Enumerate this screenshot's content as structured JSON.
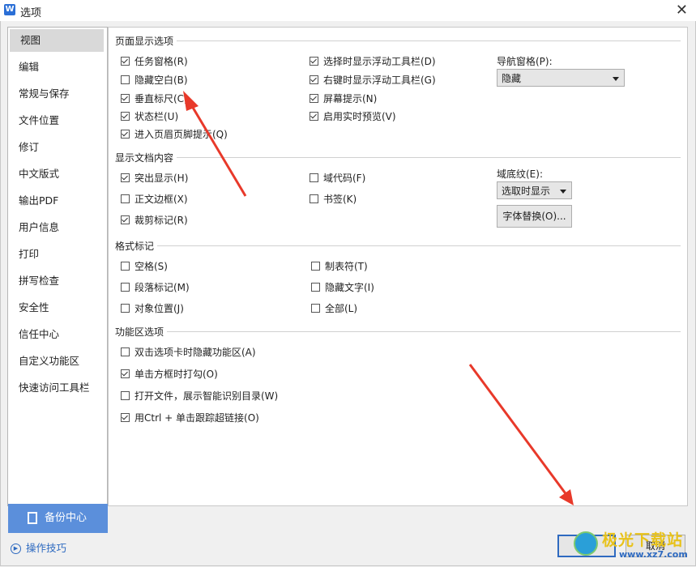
{
  "window": {
    "title": "选项",
    "app_icon": "W"
  },
  "sidebar": {
    "items": [
      {
        "label": "视图",
        "active": true
      },
      {
        "label": "编辑"
      },
      {
        "label": "常规与保存"
      },
      {
        "label": "文件位置"
      },
      {
        "label": "修订"
      },
      {
        "label": "中文版式"
      },
      {
        "label": "输出PDF"
      },
      {
        "label": "用户信息"
      },
      {
        "label": "打印"
      },
      {
        "label": "拼写检查"
      },
      {
        "label": "安全性"
      },
      {
        "label": "信任中心"
      },
      {
        "label": "自定义功能区"
      },
      {
        "label": "快速访问工具栏"
      }
    ],
    "backup_label": "备份中心",
    "tips_label": "操作技巧"
  },
  "sections": {
    "page_display": {
      "title": "页面显示选项",
      "task_pane": {
        "label": "任务窗格(R)",
        "checked": true
      },
      "hide_blank": {
        "label": "隐藏空白(B)",
        "checked": false
      },
      "vertical_ruler": {
        "label": "垂直标尺(C)",
        "checked": true
      },
      "status_bar": {
        "label": "状态栏(U)",
        "checked": true
      },
      "header_footer_tip": {
        "label": "进入页眉页脚提示(Q)",
        "checked": true
      },
      "float_toolbar_select": {
        "label": "选择时显示浮动工具栏(D)",
        "checked": true
      },
      "float_toolbar_rightclick": {
        "label": "右键时显示浮动工具栏(G)",
        "checked": true
      },
      "screen_tip": {
        "label": "屏幕提示(N)",
        "checked": true
      },
      "live_preview": {
        "label": "启用实时预览(V)",
        "checked": true
      },
      "nav_pane_label": "导航窗格(P):",
      "nav_pane_value": "隐藏"
    },
    "doc_content": {
      "title": "显示文档内容",
      "highlight": {
        "label": "突出显示(H)",
        "checked": true
      },
      "text_border": {
        "label": "正文边框(X)",
        "checked": false
      },
      "crop_marks": {
        "label": "裁剪标记(R)",
        "checked": true
      },
      "field_code": {
        "label": "域代码(F)",
        "checked": false
      },
      "bookmark": {
        "label": "书签(K)",
        "checked": false
      },
      "field_shading_label": "域底纹(E):",
      "field_shading_value": "选取时显示",
      "font_sub_button": "字体替换(O)..."
    },
    "format_marks": {
      "title": "格式标记",
      "space": {
        "label": "空格(S)",
        "checked": false
      },
      "paragraph": {
        "label": "段落标记(M)",
        "checked": false
      },
      "object_pos": {
        "label": "对象位置(J)",
        "checked": false
      },
      "tab_char": {
        "label": "制表符(T)",
        "checked": false
      },
      "hidden_text": {
        "label": "隐藏文字(I)",
        "checked": false
      },
      "all": {
        "label": "全部(L)",
        "checked": false
      }
    },
    "ribbon": {
      "title": "功能区选项",
      "dblclick_hide": {
        "label": "双击选项卡时隐藏功能区(A)",
        "checked": false
      },
      "click_box": {
        "label": "单击方框时打勾(O)",
        "checked": true
      },
      "open_file": {
        "label": "打开文件，展示智能识别目录(W)",
        "checked": false
      },
      "ctrl_click": {
        "label": "用Ctrl + 单击跟踪超链接(O)",
        "checked": true
      }
    }
  },
  "footer": {
    "ok_label": "确定",
    "cancel_label": "取消"
  },
  "watermark": {
    "text": "极光下载站",
    "url": "www.xz7.com"
  },
  "colors": {
    "accent": "#2e6ac0",
    "backup_bg": "#5b8fdb",
    "annotation_arrow": "#e8392a"
  }
}
